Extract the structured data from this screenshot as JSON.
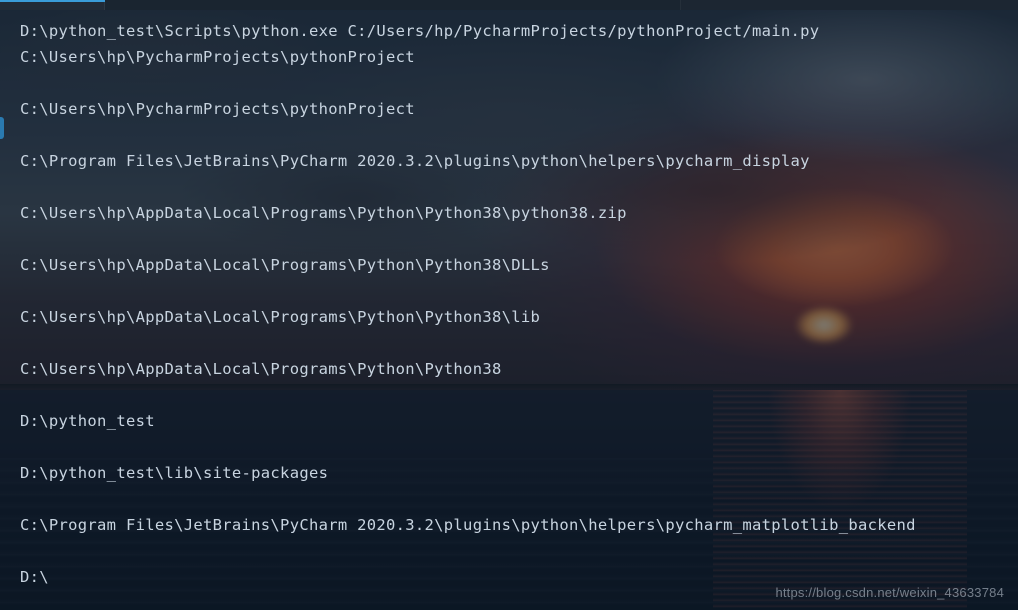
{
  "console": {
    "lines": [
      "D:\\python_test\\Scripts\\python.exe C:/Users/hp/PycharmProjects/pythonProject/main.py",
      "C:\\Users\\hp\\PycharmProjects\\pythonProject",
      "",
      "C:\\Users\\hp\\PycharmProjects\\pythonProject",
      "",
      "C:\\Program Files\\JetBrains\\PyCharm 2020.3.2\\plugins\\python\\helpers\\pycharm_display",
      "",
      "C:\\Users\\hp\\AppData\\Local\\Programs\\Python\\Python38\\python38.zip",
      "",
      "C:\\Users\\hp\\AppData\\Local\\Programs\\Python\\Python38\\DLLs",
      "",
      "C:\\Users\\hp\\AppData\\Local\\Programs\\Python\\Python38\\lib",
      "",
      "C:\\Users\\hp\\AppData\\Local\\Programs\\Python\\Python38",
      "",
      "D:\\python_test",
      "",
      "D:\\python_test\\lib\\site-packages",
      "",
      "C:\\Program Files\\JetBrains\\PyCharm 2020.3.2\\plugins\\python\\helpers\\pycharm_matplotlib_backend",
      "",
      "D:\\"
    ]
  },
  "watermark": {
    "text": "https://blog.csdn.net/weixin_43633784"
  }
}
